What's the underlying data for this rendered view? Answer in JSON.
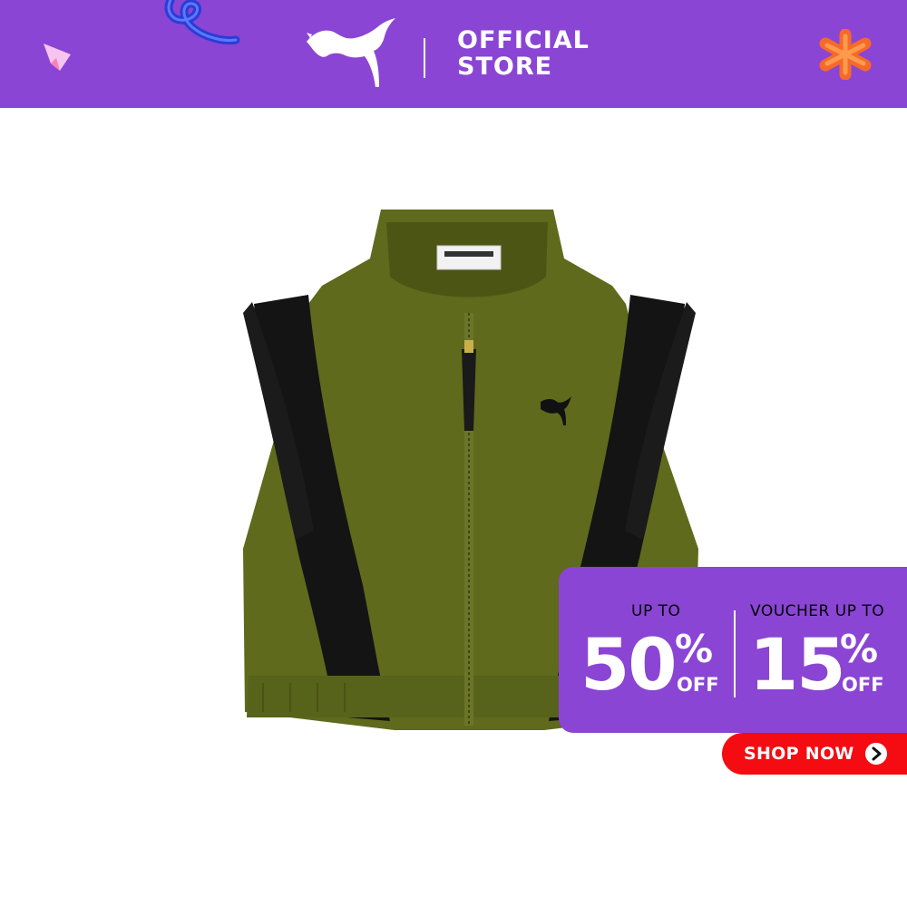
{
  "header": {
    "brand": "PUMA",
    "store_line1": "OFFICIAL",
    "store_line2": "STORE",
    "background_color": "#8a45d4"
  },
  "product": {
    "icon": "puma-cropped-vest-image",
    "color": "olive green with black panels"
  },
  "promo": {
    "left_label": "UP TO",
    "left_value": "50",
    "left_percent": "%",
    "left_off": "OFF",
    "right_label": "VOUCHER UP TO",
    "right_value": "15",
    "right_percent": "%",
    "right_off": "OFF",
    "background_color": "#8a45d4"
  },
  "cta": {
    "label": "SHOP NOW",
    "icon": "arrow-right-icon",
    "color": "#f40c12"
  }
}
